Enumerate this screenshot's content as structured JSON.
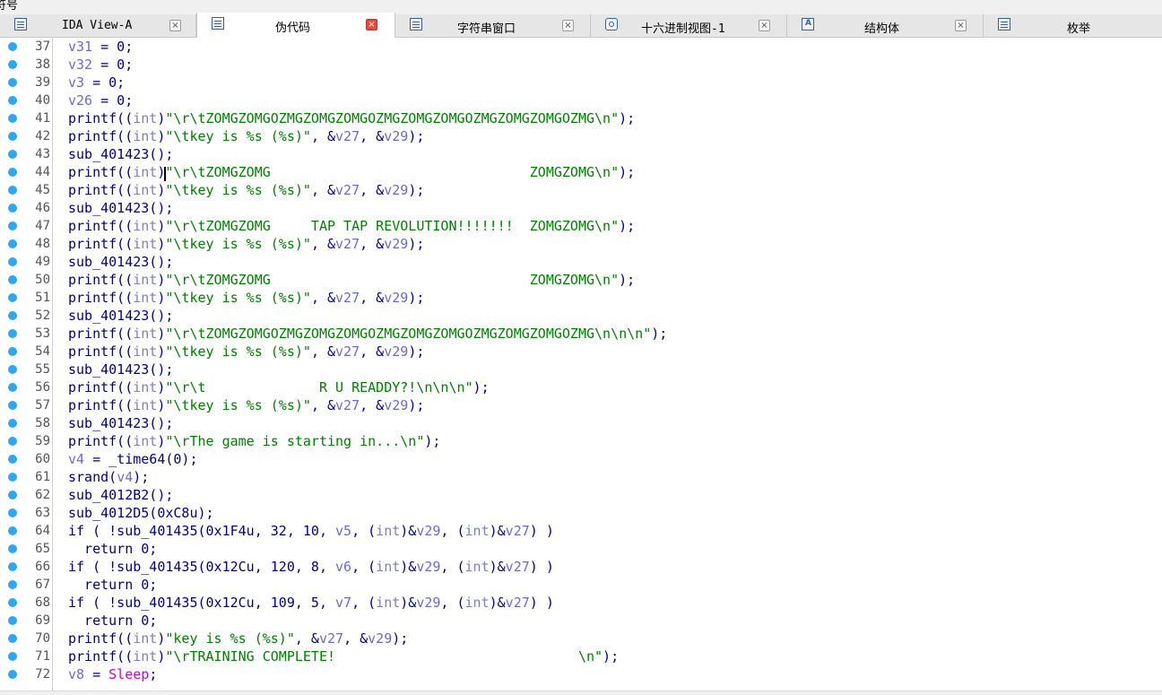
{
  "topbar": {
    "text": "符号"
  },
  "tabs": [
    {
      "label": "IDA View-A",
      "icon": "disasm-icon",
      "active": false
    },
    {
      "label": "伪代码",
      "icon": "pseudocode-icon",
      "active": true
    },
    {
      "label": "字符串窗口",
      "icon": "strings-icon",
      "active": false
    },
    {
      "label": "十六进制视图-1",
      "icon": "hex-view-icon",
      "active": false
    },
    {
      "label": "结构体",
      "icon": "structures-icon",
      "active": false
    },
    {
      "label": "枚举",
      "icon": "enums-icon",
      "active": false
    }
  ],
  "close_glyph": "×",
  "lines": [
    {
      "no": "37",
      "segs": [
        [
          "v",
          "v31"
        ],
        [
          "c",
          " = 0;"
        ]
      ]
    },
    {
      "no": "38",
      "segs": [
        [
          "v",
          "v32"
        ],
        [
          "c",
          " = 0;"
        ]
      ]
    },
    {
      "no": "39",
      "segs": [
        [
          "v",
          "v3"
        ],
        [
          "c",
          " = 0;"
        ]
      ]
    },
    {
      "no": "40",
      "segs": [
        [
          "v",
          "v26"
        ],
        [
          "c",
          " = 0;"
        ]
      ]
    },
    {
      "no": "41",
      "segs": [
        [
          "c",
          "printf(("
        ],
        [
          "k",
          "int"
        ],
        [
          "c",
          ")"
        ],
        [
          "s",
          "\"\\r\\tZOMGZOMGOZMGZOMGZOMGOZMGZOMGZOMGOZMGZOMGZOMGOZMG\\n\""
        ],
        [
          "c",
          ");"
        ]
      ]
    },
    {
      "no": "42",
      "segs": [
        [
          "c",
          "printf(("
        ],
        [
          "k",
          "int"
        ],
        [
          "c",
          ")"
        ],
        [
          "s",
          "\"\\tkey is %s (%s)\""
        ],
        [
          "c",
          ", &"
        ],
        [
          "v",
          "v27"
        ],
        [
          "c",
          ", &"
        ],
        [
          "v",
          "v29"
        ],
        [
          "c",
          ");"
        ]
      ]
    },
    {
      "no": "43",
      "segs": [
        [
          "c",
          "sub_401423();"
        ]
      ]
    },
    {
      "no": "44",
      "segs": [
        [
          "c",
          "printf(("
        ],
        [
          "k",
          "int"
        ],
        [
          "c",
          ")"
        ],
        [
          "s",
          "\"\\r\\tZOMGZOMG                                ZOMGZOMG\\n\""
        ],
        [
          "c",
          ");"
        ]
      ]
    },
    {
      "no": "45",
      "segs": [
        [
          "c",
          "printf(("
        ],
        [
          "k",
          "int"
        ],
        [
          "c",
          ")"
        ],
        [
          "s",
          "\"\\tkey is %s (%s)\""
        ],
        [
          "c",
          ", &"
        ],
        [
          "v",
          "v27"
        ],
        [
          "c",
          ", &"
        ],
        [
          "v",
          "v29"
        ],
        [
          "c",
          ");"
        ]
      ]
    },
    {
      "no": "46",
      "segs": [
        [
          "c",
          "sub_401423();"
        ]
      ]
    },
    {
      "no": "47",
      "segs": [
        [
          "c",
          "printf(("
        ],
        [
          "k",
          "int"
        ],
        [
          "c",
          ")"
        ],
        [
          "s",
          "\"\\r\\tZOMGZOMG     TAP TAP REVOLUTION!!!!!!!  ZOMGZOMG\\n\""
        ],
        [
          "c",
          ");"
        ]
      ]
    },
    {
      "no": "48",
      "segs": [
        [
          "c",
          "printf(("
        ],
        [
          "k",
          "int"
        ],
        [
          "c",
          ")"
        ],
        [
          "s",
          "\"\\tkey is %s (%s)\""
        ],
        [
          "c",
          ", &"
        ],
        [
          "v",
          "v27"
        ],
        [
          "c",
          ", &"
        ],
        [
          "v",
          "v29"
        ],
        [
          "c",
          ");"
        ]
      ]
    },
    {
      "no": "49",
      "segs": [
        [
          "c",
          "sub_401423();"
        ]
      ]
    },
    {
      "no": "50",
      "segs": [
        [
          "c",
          "printf(("
        ],
        [
          "k",
          "int"
        ],
        [
          "c",
          ")"
        ],
        [
          "s",
          "\"\\r\\tZOMGZOMG                                ZOMGZOMG\\n\""
        ],
        [
          "c",
          ");"
        ]
      ]
    },
    {
      "no": "51",
      "segs": [
        [
          "c",
          "printf(("
        ],
        [
          "k",
          "int"
        ],
        [
          "c",
          ")"
        ],
        [
          "s",
          "\"\\tkey is %s (%s)\""
        ],
        [
          "c",
          ", &"
        ],
        [
          "v",
          "v27"
        ],
        [
          "c",
          ", &"
        ],
        [
          "v",
          "v29"
        ],
        [
          "c",
          ");"
        ]
      ]
    },
    {
      "no": "52",
      "segs": [
        [
          "c",
          "sub_401423();"
        ]
      ]
    },
    {
      "no": "53",
      "segs": [
        [
          "c",
          "printf(("
        ],
        [
          "k",
          "int"
        ],
        [
          "c",
          ")"
        ],
        [
          "s",
          "\"\\r\\tZOMGZOMGOZMGZOMGZOMGOZMGZOMGZOMGOZMGZOMGZOMGOZMG\\n\\n\\n\""
        ],
        [
          "c",
          ");"
        ]
      ]
    },
    {
      "no": "54",
      "segs": [
        [
          "c",
          "printf(("
        ],
        [
          "k",
          "int"
        ],
        [
          "c",
          ")"
        ],
        [
          "s",
          "\"\\tkey is %s (%s)\""
        ],
        [
          "c",
          ", &"
        ],
        [
          "v",
          "v27"
        ],
        [
          "c",
          ", &"
        ],
        [
          "v",
          "v29"
        ],
        [
          "c",
          ");"
        ]
      ]
    },
    {
      "no": "55",
      "segs": [
        [
          "c",
          "sub_401423();"
        ]
      ]
    },
    {
      "no": "56",
      "segs": [
        [
          "c",
          "printf(("
        ],
        [
          "k",
          "int"
        ],
        [
          "c",
          ")"
        ],
        [
          "s",
          "\"\\r\\t              R U READDY?!\\n\\n\\n\""
        ],
        [
          "c",
          ");"
        ]
      ]
    },
    {
      "no": "57",
      "segs": [
        [
          "c",
          "printf(("
        ],
        [
          "k",
          "int"
        ],
        [
          "c",
          ")"
        ],
        [
          "s",
          "\"\\tkey is %s (%s)\""
        ],
        [
          "c",
          ", &"
        ],
        [
          "v",
          "v27"
        ],
        [
          "c",
          ", &"
        ],
        [
          "v",
          "v29"
        ],
        [
          "c",
          ");"
        ]
      ]
    },
    {
      "no": "58",
      "segs": [
        [
          "c",
          "sub_401423();"
        ]
      ]
    },
    {
      "no": "59",
      "segs": [
        [
          "c",
          "printf(("
        ],
        [
          "k",
          "int"
        ],
        [
          "c",
          ")"
        ],
        [
          "s",
          "\"\\rThe game is starting in...\\n\""
        ],
        [
          "c",
          ");"
        ]
      ]
    },
    {
      "no": "60",
      "segs": [
        [
          "v",
          "v4"
        ],
        [
          "c",
          " = _time64(0);"
        ]
      ]
    },
    {
      "no": "61",
      "segs": [
        [
          "c",
          "srand("
        ],
        [
          "v",
          "v4"
        ],
        [
          "c",
          ");"
        ]
      ]
    },
    {
      "no": "62",
      "segs": [
        [
          "c",
          "sub_4012B2();"
        ]
      ]
    },
    {
      "no": "63",
      "segs": [
        [
          "c",
          "sub_4012D5(0xC8u);"
        ]
      ]
    },
    {
      "no": "64",
      "segs": [
        [
          "c",
          "if ( !sub_401435(0x1F4u, 32, 10, "
        ],
        [
          "v",
          "v5"
        ],
        [
          "c",
          ", ("
        ],
        [
          "k",
          "int"
        ],
        [
          "c",
          ")&"
        ],
        [
          "v",
          "v29"
        ],
        [
          "c",
          ", ("
        ],
        [
          "k",
          "int"
        ],
        [
          "c",
          ")&"
        ],
        [
          "v",
          "v27"
        ],
        [
          "c",
          ") )"
        ]
      ]
    },
    {
      "no": "65",
      "segs": [
        [
          "c",
          "  return 0;"
        ]
      ]
    },
    {
      "no": "66",
      "segs": [
        [
          "c",
          "if ( !sub_401435(0x12Cu, 120, 8, "
        ],
        [
          "v",
          "v6"
        ],
        [
          "c",
          ", ("
        ],
        [
          "k",
          "int"
        ],
        [
          "c",
          ")&"
        ],
        [
          "v",
          "v29"
        ],
        [
          "c",
          ", ("
        ],
        [
          "k",
          "int"
        ],
        [
          "c",
          ")&"
        ],
        [
          "v",
          "v27"
        ],
        [
          "c",
          ") )"
        ]
      ]
    },
    {
      "no": "67",
      "segs": [
        [
          "c",
          "  return 0;"
        ]
      ]
    },
    {
      "no": "68",
      "segs": [
        [
          "c",
          "if ( !sub_401435(0x12Cu, 109, 5, "
        ],
        [
          "v",
          "v7"
        ],
        [
          "c",
          ", ("
        ],
        [
          "k",
          "int"
        ],
        [
          "c",
          ")&"
        ],
        [
          "v",
          "v29"
        ],
        [
          "c",
          ", ("
        ],
        [
          "k",
          "int"
        ],
        [
          "c",
          ")&"
        ],
        [
          "v",
          "v27"
        ],
        [
          "c",
          ") )"
        ]
      ]
    },
    {
      "no": "69",
      "segs": [
        [
          "c",
          "  return 0;"
        ]
      ]
    },
    {
      "no": "70",
      "segs": [
        [
          "c",
          "printf(("
        ],
        [
          "k",
          "int"
        ],
        [
          "c",
          ")"
        ],
        [
          "s",
          "\"key is %s (%s)\""
        ],
        [
          "c",
          ", &"
        ],
        [
          "v",
          "v27"
        ],
        [
          "c",
          ", &"
        ],
        [
          "v",
          "v29"
        ],
        [
          "c",
          ");"
        ]
      ]
    },
    {
      "no": "71",
      "segs": [
        [
          "c",
          "printf(("
        ],
        [
          "k",
          "int"
        ],
        [
          "c",
          ")"
        ],
        [
          "s",
          "\"\\rTRAINING COMPLETE!                              \\n\""
        ],
        [
          "c",
          ");"
        ]
      ]
    },
    {
      "no": "72",
      "segs": [
        [
          "v",
          "v8"
        ],
        [
          "c",
          " = "
        ],
        [
          "m",
          "Sleep"
        ],
        [
          "c",
          ";"
        ]
      ]
    }
  ]
}
